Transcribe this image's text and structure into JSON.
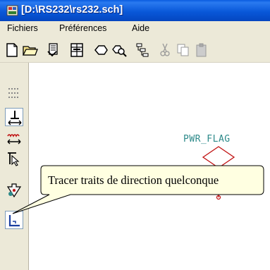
{
  "window": {
    "title": "[D:\\RS232\\rs232.sch]"
  },
  "menubar": {
    "items": [
      "Fichiers",
      "Préférences",
      "Aide"
    ]
  },
  "toolbar": {
    "icons": [
      "new-sheet-icon",
      "open-icon",
      "library-icon",
      "save-library-icon",
      "zoom-fit-icon",
      "zoom-area-icon",
      "hierarchy-icon",
      "cut-icon",
      "copy-icon",
      "paste-icon"
    ]
  },
  "left_toolbar": {
    "icons": [
      "grip-icon",
      "vertical-pin-icon",
      "bus-arrow-icon",
      "pin-select-icon",
      "component-icon",
      "draw-line-icon"
    ]
  },
  "canvas": {
    "power_flag_label": "PWR_FLAG"
  },
  "tooltip": {
    "text": "Tracer traits de direction quelconque"
  },
  "colors": {
    "title_bar": "#0958d9",
    "tooltip_bg": "#ffffe1",
    "schematic_cyan": "#2d8a8a",
    "schematic_red": "#c01010"
  }
}
